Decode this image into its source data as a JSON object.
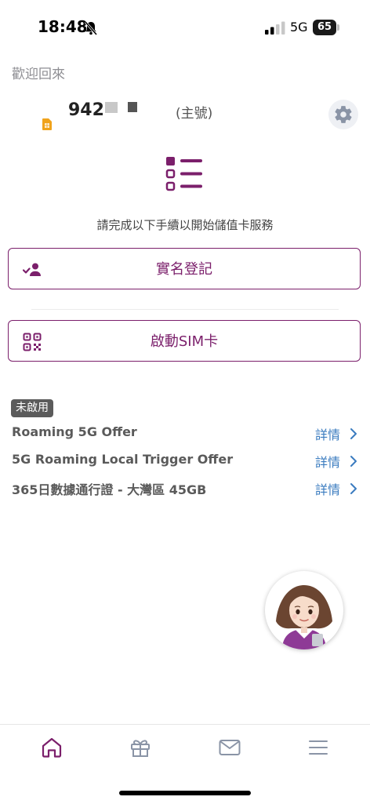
{
  "status_bar": {
    "time": "18:48",
    "network": "5G",
    "battery": "65"
  },
  "welcome": "歡迎回來",
  "account": {
    "number_visible": "942",
    "label": "(主號)"
  },
  "instruction": "請完成以下手續以開始儲值卡服務",
  "actions": {
    "register": "實名登記",
    "activate": "啟動SIM卡"
  },
  "status_badge": "未啟用",
  "offers": [
    {
      "name": "Roaming 5G Offer",
      "detail": "詳情"
    },
    {
      "name": "5G Roaming Local Trigger Offer",
      "detail": "詳情"
    },
    {
      "name": "365日數據通行證 - 大灣區 45GB",
      "detail": "詳情"
    }
  ],
  "colors": {
    "brand": "#7b1f6b",
    "link": "#3a7bbf",
    "nav_active": "#7b1f6b",
    "nav_inactive": "#8a94a6"
  },
  "icons": [
    "bell-slash-icon",
    "signal-icon",
    "sim-icon",
    "gear-icon",
    "checklist-icon",
    "user-check-icon",
    "qr-code-icon",
    "chevron-right-icon",
    "home-icon",
    "gift-icon",
    "mail-icon",
    "menu-icon"
  ]
}
